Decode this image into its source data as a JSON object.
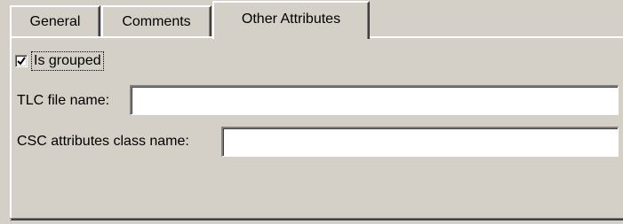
{
  "tabs": [
    {
      "label": "General",
      "active": false
    },
    {
      "label": "Comments",
      "active": false
    },
    {
      "label": "Other Attributes",
      "active": true
    }
  ],
  "is_grouped": {
    "label": "Is grouped",
    "checked": true
  },
  "fields": {
    "tlc_file_name": {
      "label": "TLC file name:",
      "value": ""
    },
    "csc_attributes_class_name": {
      "label": "CSC attributes class name:",
      "value": ""
    }
  },
  "icons": {
    "checkbox_check": "check-icon"
  }
}
